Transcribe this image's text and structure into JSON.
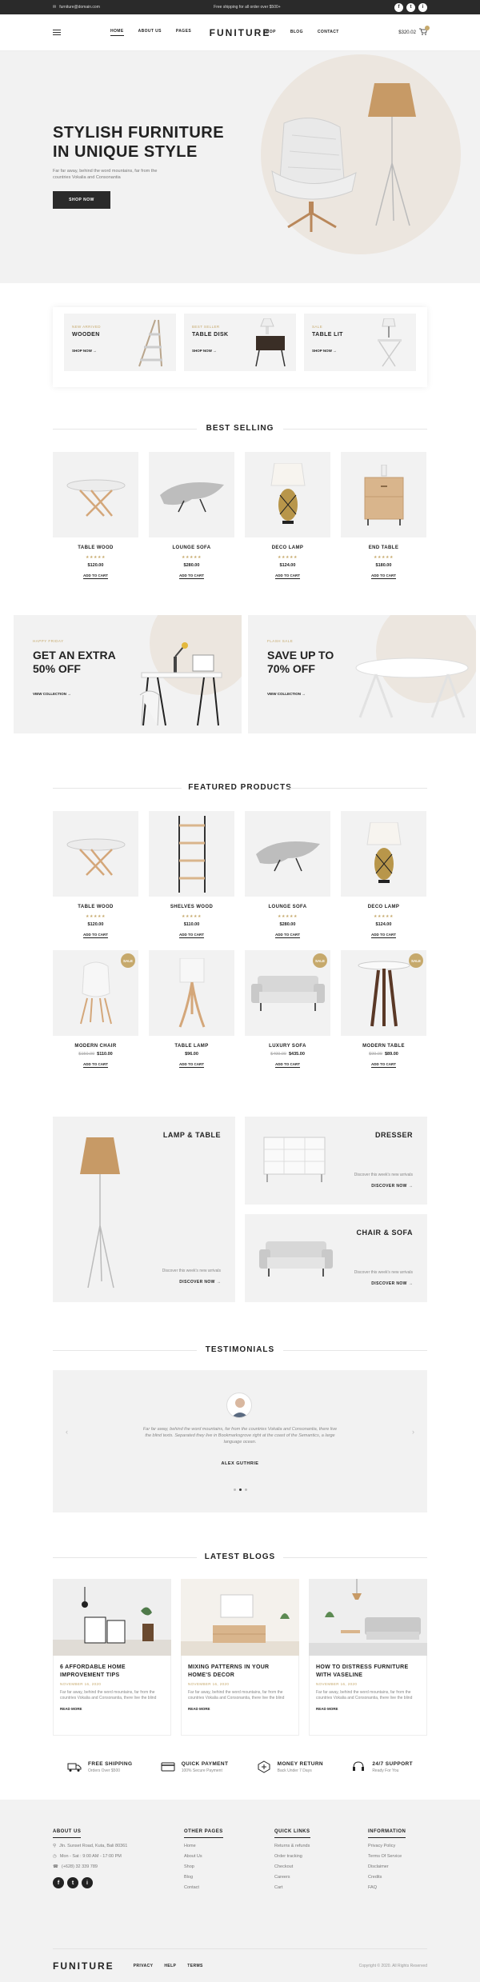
{
  "topbar": {
    "email": "furniture@domain.com",
    "shipping": "Free shipping for all order over $500+",
    "socials": [
      "f",
      "t",
      "i"
    ]
  },
  "header": {
    "nav": [
      "HOME",
      "ABOUT US",
      "PAGES"
    ],
    "nav_right": [
      "SHOP",
      "BLOG",
      "CONTACT"
    ],
    "logo": "FUNITURE",
    "cart_total": "$320.02"
  },
  "hero": {
    "title_line1": "STYLISH FURNITURE",
    "title_line2": "IN UNIQUE STYLE",
    "text": "Far far away, behind the word mountains, far from the countries Vokalia and Consonantia",
    "cta": "SHOP NOW"
  },
  "categories": [
    {
      "tag": "NEW ARRIVED",
      "name": "WOODEN",
      "link": "SHOP NOW →"
    },
    {
      "tag": "BEST SELLER",
      "name": "TABLE DISK",
      "link": "SHOP NOW →"
    },
    {
      "tag": "SALE",
      "name": "TABLE LIT",
      "link": "SHOP NOW →"
    }
  ],
  "best_selling": {
    "title": "BEST SELLING",
    "products": [
      {
        "name": "TABLE WOOD",
        "stars": "★★★★★",
        "price": "$120.00",
        "cta": "ADD TO CART"
      },
      {
        "name": "LOUNGE SOFA",
        "stars": "★★★★★",
        "price": "$280.00",
        "cta": "ADD TO CART"
      },
      {
        "name": "DECO LAMP",
        "stars": "★★★★★",
        "price": "$124.00",
        "cta": "ADD TO CART"
      },
      {
        "name": "END TABLE",
        "stars": "★★★★★",
        "price": "$180.00",
        "cta": "ADD TO CART"
      }
    ]
  },
  "banners": [
    {
      "tag": "HAPPY FRIDAY",
      "title_line1": "GET AN EXTRA",
      "title_line2": "50% OFF",
      "link": "VIEW COLLECTION →"
    },
    {
      "tag": "FLASH SALE",
      "title_line1": "SAVE UP TO",
      "title_line2": "70% OFF",
      "link": "VIEW COLLECTION →"
    }
  ],
  "featured": {
    "title": "FEATURED PRODUCTS",
    "products": [
      {
        "name": "TABLE WOOD",
        "stars": "★★★★★",
        "price": "$120.00",
        "old": "",
        "sale": "",
        "cta": "ADD TO CART"
      },
      {
        "name": "SHELVES WOOD",
        "stars": "★★★★★",
        "price": "$110.00",
        "old": "",
        "sale": "",
        "cta": "ADD TO CART"
      },
      {
        "name": "LOUNGE SOFA",
        "stars": "★★★★★",
        "price": "$280.00",
        "old": "",
        "sale": "",
        "cta": "ADD TO CART"
      },
      {
        "name": "DECO LAMP",
        "stars": "★★★★★",
        "price": "$124.00",
        "old": "",
        "sale": "",
        "cta": "ADD TO CART"
      },
      {
        "name": "MODERN CHAIR",
        "stars": "",
        "price": "$110.00",
        "old": "$150.00",
        "sale": "SALE",
        "cta": "ADD TO CART"
      },
      {
        "name": "TABLE LAMP",
        "stars": "",
        "price": "$96.00",
        "old": "",
        "sale": "",
        "cta": "ADD TO CART"
      },
      {
        "name": "LUXURY SOFA",
        "stars": "",
        "price": "$435.00",
        "old": "$499.00",
        "sale": "SALE",
        "cta": "ADD TO CART"
      },
      {
        "name": "MODERN TABLE",
        "stars": "",
        "price": "$89.00",
        "old": "$99.00",
        "sale": "SALE",
        "cta": "ADD TO CART"
      }
    ]
  },
  "collections": [
    {
      "title": "LAMP & TABLE",
      "desc": "Discover this week's new arrivals",
      "link": "DISCOVER NOW →"
    },
    {
      "title": "DRESSER",
      "desc": "Discover this week's new arrivals",
      "link": "DISCOVER NOW →"
    },
    {
      "title": "CHAIR & SOFA",
      "desc": "Discover this week's new arrivals",
      "link": "DISCOVER NOW →"
    }
  ],
  "testimonials": {
    "title": "TESTIMONIALS",
    "quote": "Far far away, behind the word mountains, far from the countries Vokalia and Consonantia, there live the blind texts. Separated they live in Bookmarksgrove right at the coast of the Semantics, a large language ocean.",
    "author": "ALEX GUTHRIE",
    "prev": "‹",
    "next": "›"
  },
  "blogs": {
    "title": "LATEST BLOGS",
    "posts": [
      {
        "title": "6 AFFORDABLE HOME IMPROVEMENT TIPS",
        "date": "NOVEMBER 16, 2020",
        "text": "Far far away, behind the word mountains, far from the countries Vokalia and Consonantia, there live the blind",
        "more": "READ MORE"
      },
      {
        "title": "MIXING PATTERNS IN YOUR HOME'S DECOR",
        "date": "NOVEMBER 16, 2020",
        "text": "Far far away, behind the word mountains, far from the countries Vokalia and Consonantia, there live the blind",
        "more": "READ MORE"
      },
      {
        "title": "HOW TO DISTRESS FURNITURE WITH VASELINE",
        "date": "NOVEMBER 16, 2020",
        "text": "Far far away, behind the word mountains, far from the countries Vokalia and Consonantia, there live the blind",
        "more": "READ MORE"
      }
    ]
  },
  "features": [
    {
      "title": "FREE SHIPPING",
      "sub": "Orders Over $500",
      "icon": "truck-icon"
    },
    {
      "title": "QUICK PAYMENT",
      "sub": "100% Secure Payment",
      "icon": "card-icon"
    },
    {
      "title": "MONEY RETURN",
      "sub": "Back Under 7 Days",
      "icon": "return-icon"
    },
    {
      "title": "24/7 SUPPORT",
      "sub": "Ready For You",
      "icon": "support-icon"
    }
  ],
  "footer": {
    "about": {
      "title": "ABOUT US",
      "address": "Jln. Sunset Road, Kuta, Bali 80361",
      "hours": "Mon - Sat : 9:00 AM - 17:00 PM",
      "phone": "(+628) 32 339 789"
    },
    "other": {
      "title": "OTHER PAGES",
      "items": [
        "Home",
        "About Us",
        "Shop",
        "Blog",
        "Contact"
      ]
    },
    "quick": {
      "title": "QUICK LINKS",
      "items": [
        "Returns & refunds",
        "Order tracking",
        "Checkout",
        "Careers",
        "Cart"
      ]
    },
    "info": {
      "title": "INFORMATION",
      "items": [
        "Privacy Policy",
        "Terms Of Service",
        "Disclaimer",
        "Credits",
        "FAQ"
      ]
    },
    "logo": "FUNITURE",
    "links": [
      "PRIVACY",
      "HELP",
      "TERMS"
    ],
    "copyright": "Copyright © 2020. All Rights Reserved"
  },
  "colors": {
    "accent": "#c6a96c",
    "dark": "#2a2a2a",
    "light_bg": "#f2f2f2",
    "circle": "#ece6df"
  }
}
